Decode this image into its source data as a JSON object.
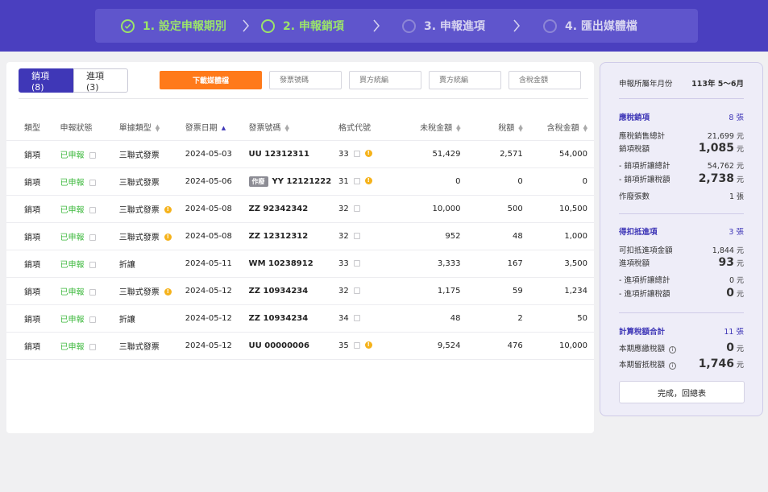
{
  "steps": [
    {
      "label": "1. 設定申報期別",
      "state": "done"
    },
    {
      "label": "2. 申報銷項",
      "state": "active"
    },
    {
      "label": "3. 申報進項",
      "state": "todo"
    },
    {
      "label": "4. 匯出媒體檔",
      "state": "todo"
    }
  ],
  "tabs": {
    "sales": "銷項 (8)",
    "purchases": "進項 (3)"
  },
  "toolbar": {
    "download_label": "下載媒體檔",
    "filters": [
      "發票號碼",
      "買方統編",
      "賣方統編",
      "含稅金額"
    ]
  },
  "table": {
    "headers": {
      "type": "類型",
      "status": "申報狀態",
      "kind": "單據類型",
      "date": "發票日期",
      "number": "發票號碼",
      "format": "格式代號",
      "untaxed": "未稅金額",
      "tax": "稅額",
      "total": "含稅金額"
    },
    "rows": [
      {
        "type": "銷項",
        "status": "已申報",
        "kind": "三聯式發票",
        "date": "2024-05-03",
        "number": "UU 12312311",
        "format": "33",
        "untaxed": "51,429",
        "tax": "2,571",
        "total": "54,000"
      },
      {
        "type": "銷項",
        "status": "已申報",
        "kind": "三聯式發票",
        "date": "2024-05-06",
        "number": "YY 12121222",
        "void": "作廢",
        "format": "31",
        "untaxed": "0",
        "tax": "0",
        "total": "0"
      },
      {
        "type": "銷項",
        "status": "已申報",
        "kind": "三聯式發票",
        "date": "2024-05-08",
        "number": "ZZ 92342342",
        "format": "32",
        "untaxed": "10,000",
        "tax": "500",
        "total": "10,500"
      },
      {
        "type": "銷項",
        "status": "已申報",
        "kind": "三聯式發票",
        "date": "2024-05-08",
        "number": "ZZ 12312312",
        "format": "32",
        "untaxed": "952",
        "tax": "48",
        "total": "1,000"
      },
      {
        "type": "銷項",
        "status": "已申報",
        "kind": "折讓",
        "date": "2024-05-11",
        "number": "WM 10238912",
        "format": "33",
        "untaxed": "3,333",
        "tax": "167",
        "total": "3,500"
      },
      {
        "type": "銷項",
        "status": "已申報",
        "kind": "三聯式發票",
        "date": "2024-05-12",
        "number": "ZZ 10934234",
        "format": "32",
        "untaxed": "1,175",
        "tax": "59",
        "total": "1,234"
      },
      {
        "type": "銷項",
        "status": "已申報",
        "kind": "折讓",
        "date": "2024-05-12",
        "number": "ZZ 10934234",
        "format": "34",
        "untaxed": "48",
        "tax": "2",
        "total": "50"
      },
      {
        "type": "銷項",
        "status": "已申報",
        "kind": "三聯式發票",
        "date": "2024-05-12",
        "number": "UU 00000006",
        "format": "35",
        "untaxed": "9,524",
        "tax": "476",
        "total": "10,000"
      }
    ]
  },
  "summary": {
    "period_label": "申報所屬年月份",
    "period_value": "113年 5～6月",
    "sales": {
      "title": "應稅銷項",
      "count": "8 張",
      "rows": [
        {
          "label": "應稅銷售總計",
          "value": "21,699",
          "unit": "元",
          "big": false
        },
        {
          "label": "銷項稅額",
          "value": "1,085",
          "unit": "元",
          "big": true
        },
        {
          "label": "- 銷項折讓總計",
          "value": "54,762",
          "unit": "元",
          "big": false
        },
        {
          "label": "- 銷項折讓稅額",
          "value": "2,738",
          "unit": "元",
          "big": true
        },
        {
          "label": "作廢張數",
          "value": "1",
          "unit": "張",
          "big": false
        }
      ]
    },
    "purchases": {
      "title": "得扣抵進項",
      "count": "3 張",
      "rows": [
        {
          "label": "可扣抵進項金額",
          "value": "1,844",
          "unit": "元",
          "big": false
        },
        {
          "label": "進項稅額",
          "value": "93",
          "unit": "元",
          "big": true
        },
        {
          "label": "- 進項折讓總計",
          "value": "0",
          "unit": "元",
          "big": false
        },
        {
          "label": "- 進項折讓稅額",
          "value": "0",
          "unit": "元",
          "big": true
        }
      ]
    },
    "total": {
      "title": "計算稅額合計",
      "count": "11 張",
      "rows": [
        {
          "label": "本期應繳稅額",
          "value": "0",
          "unit": "元",
          "big": true
        },
        {
          "label": "本期留抵稅額",
          "value": "1,746",
          "unit": "元",
          "big": true
        }
      ]
    },
    "done_label": "完成，回總表"
  }
}
